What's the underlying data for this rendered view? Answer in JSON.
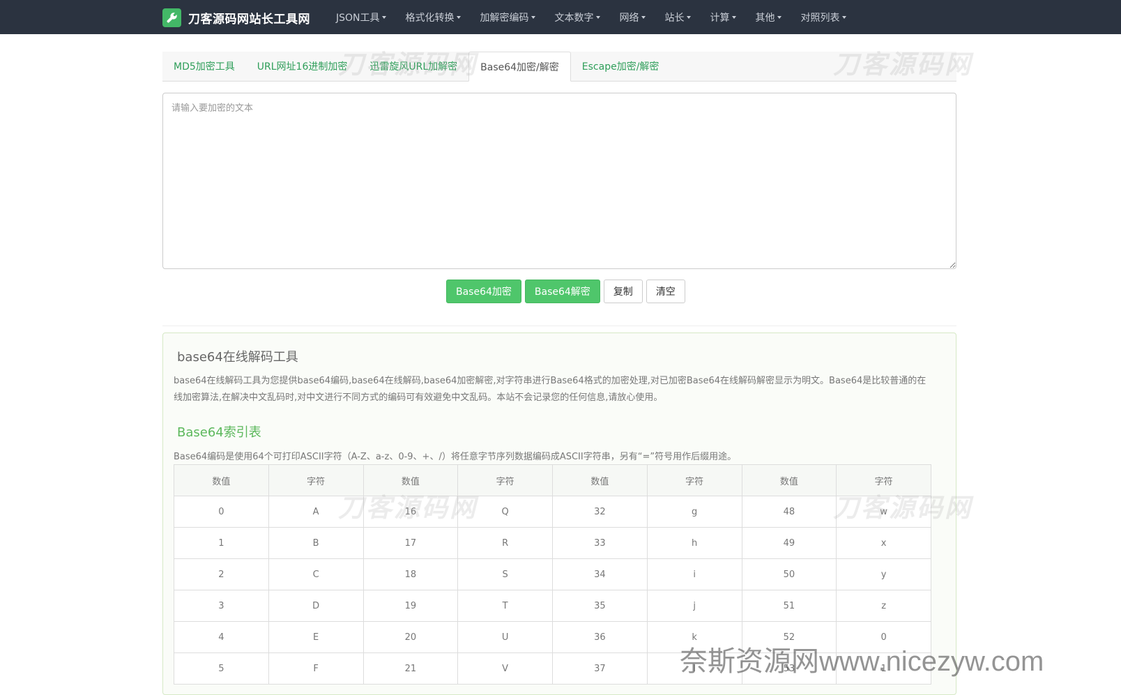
{
  "navbar": {
    "brand": "刀客源码网站长工具网",
    "brand_icon": "wrench-icon",
    "items": [
      "JSON工具",
      "格式化转换",
      "加解密编码",
      "文本数字",
      "网络",
      "站长",
      "计算",
      "其他",
      "对照列表"
    ]
  },
  "tabs": [
    "MD5加密工具",
    "URL网址16进制加密",
    "迅雷旋风URL加解密",
    "Base64加密/解密",
    "Escape加密/解密"
  ],
  "active_tab": "Base64加密/解密",
  "input": {
    "placeholder": "请输入要加密的文本",
    "value": ""
  },
  "buttons": {
    "encode": "Base64加密",
    "decode": "Base64解密",
    "copy": "复制",
    "clear": "清空"
  },
  "info": {
    "title": "base64在线解码工具",
    "description": "base64在线解码工具为您提供base64编码,base64在线解码,base64加密解密,对字符串进行Base64格式的加密处理,对已加密Base64在线解码解密显示为明文。Base64是比较普通的在线加密算法,在解决中文乱码时,对中文进行不同方式的编码可有效避免中文乱码。本站不会记录您的任何信息,请放心使用。",
    "index_title": "Base64索引表",
    "index_desc": "Base64编码是使用64个可打印ASCII字符（A-Z、a-z、0-9、+、/）将任意字节序列数据编码成ASCII字符串，另有“=”符号用作后缀用途。"
  },
  "table": {
    "headers": [
      "数值",
      "字符",
      "数值",
      "字符",
      "数值",
      "字符",
      "数值",
      "字符"
    ],
    "rows": [
      [
        "0",
        "A",
        "16",
        "Q",
        "32",
        "g",
        "48",
        "w"
      ],
      [
        "1",
        "B",
        "17",
        "R",
        "33",
        "h",
        "49",
        "x"
      ],
      [
        "2",
        "C",
        "18",
        "S",
        "34",
        "i",
        "50",
        "y"
      ],
      [
        "3",
        "D",
        "19",
        "T",
        "35",
        "j",
        "51",
        "z"
      ],
      [
        "4",
        "E",
        "20",
        "U",
        "36",
        "k",
        "52",
        "0"
      ],
      [
        "5",
        "F",
        "21",
        "V",
        "37",
        "l",
        "53",
        "1"
      ]
    ]
  },
  "watermarks": {
    "logo_text": "刀客源码网",
    "bottom": "奈斯资源网www.nicezyw.com"
  },
  "colors": {
    "navbar_bg": "#2b3340",
    "accent_green": "#4fc66b",
    "link_green": "#2e9e59"
  }
}
